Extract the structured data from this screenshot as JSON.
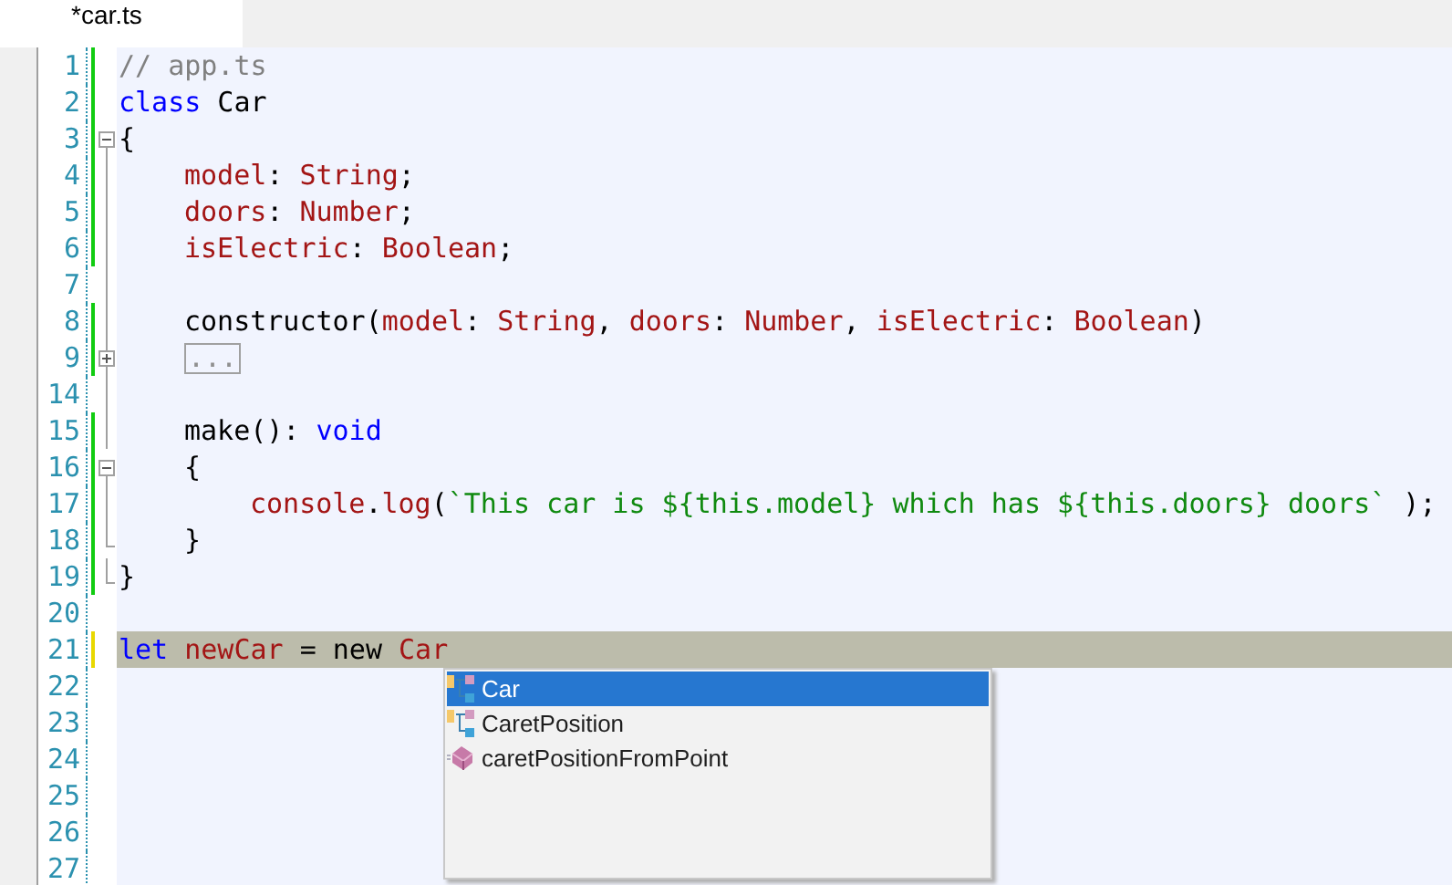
{
  "tabs": [
    {
      "title": "*car.ts",
      "selected": true
    }
  ],
  "editor": {
    "lines": [
      {
        "number": "1",
        "modified": true,
        "saved": true,
        "current": false,
        "tokens": [
          {
            "kind": "comment",
            "text": "// app.ts"
          }
        ]
      },
      {
        "number": "2",
        "modified": true,
        "saved": true,
        "current": false,
        "tokens": [
          {
            "kind": "keyword",
            "text": "class"
          },
          {
            "kind": "plain",
            "text": " Car"
          }
        ]
      },
      {
        "number": "3",
        "modified": true,
        "saved": true,
        "fold_button": true,
        "collapsed": false,
        "current": false,
        "tokens": [
          {
            "kind": "plain",
            "text": "{"
          }
        ]
      },
      {
        "number": "4",
        "modified": true,
        "saved": true,
        "fold_line": true,
        "indented": true,
        "current": false,
        "tokens": [
          {
            "kind": "identifier",
            "text": "model"
          },
          {
            "kind": "plain",
            "text": ": "
          },
          {
            "kind": "identifier",
            "text": "String"
          },
          {
            "kind": "plain",
            "text": ";"
          }
        ]
      },
      {
        "number": "5",
        "modified": true,
        "saved": true,
        "fold_line": true,
        "indented": true,
        "current": false,
        "tokens": [
          {
            "kind": "identifier",
            "text": "doors"
          },
          {
            "kind": "plain",
            "text": ": "
          },
          {
            "kind": "identifier",
            "text": "Number"
          },
          {
            "kind": "plain",
            "text": ";"
          }
        ]
      },
      {
        "number": "6",
        "modified": true,
        "saved": true,
        "fold_line": true,
        "indented": true,
        "current": false,
        "tokens": [
          {
            "kind": "identifier",
            "text": "isElectric"
          },
          {
            "kind": "plain",
            "text": ": "
          },
          {
            "kind": "identifier",
            "text": "Boolean"
          },
          {
            "kind": "plain",
            "text": ";"
          }
        ]
      },
      {
        "number": "7",
        "modified": false,
        "fold_line": true,
        "current": false
      },
      {
        "number": "8",
        "modified": true,
        "saved": true,
        "fold_line": true,
        "indented": true,
        "current": false,
        "tokens": [
          {
            "kind": "plain",
            "text": "constructor("
          },
          {
            "kind": "identifier",
            "text": "model"
          },
          {
            "kind": "plain",
            "text": ": "
          },
          {
            "kind": "identifier",
            "text": "String"
          },
          {
            "kind": "plain",
            "text": ", "
          },
          {
            "kind": "identifier",
            "text": "doors"
          },
          {
            "kind": "plain",
            "text": ": "
          },
          {
            "kind": "identifier",
            "text": "Number"
          },
          {
            "kind": "plain",
            "text": ", "
          },
          {
            "kind": "identifier",
            "text": "isElectric"
          },
          {
            "kind": "plain",
            "text": ": "
          },
          {
            "kind": "identifier",
            "text": "Boolean"
          },
          {
            "kind": "plain",
            "text": ")"
          }
        ]
      },
      {
        "number": "9",
        "modified": true,
        "saved": true,
        "fold_button": true,
        "collapsed": true,
        "indented": true,
        "current": false,
        "tokens": [
          {
            "kind": "collapsed",
            "text": "..."
          }
        ]
      },
      {
        "number": "14",
        "modified": false,
        "fold_line": true,
        "current": false
      },
      {
        "number": "15",
        "modified": true,
        "saved": true,
        "fold_line": true,
        "indented": true,
        "current": false,
        "tokens": [
          {
            "kind": "plain",
            "text": "make(): "
          },
          {
            "kind": "keyword",
            "text": "void"
          }
        ]
      },
      {
        "number": "16",
        "modified": true,
        "saved": true,
        "fold_button": true,
        "collapsed": false,
        "indented": true,
        "current": false,
        "tokens": [
          {
            "kind": "plain",
            "text": "{"
          }
        ]
      },
      {
        "number": "17",
        "modified": true,
        "saved": true,
        "fold_line": true,
        "indented": true,
        "nested": true,
        "current": false,
        "tokens": [
          {
            "kind": "identifier",
            "text": "console"
          },
          {
            "kind": "plain",
            "text": "."
          },
          {
            "kind": "identifier",
            "text": "log"
          },
          {
            "kind": "plain",
            "text": "("
          },
          {
            "kind": "string",
            "text": "`This car is ${this.model} which has ${this.doors} doors`"
          },
          {
            "kind": "plain",
            "text": " );"
          }
        ]
      },
      {
        "number": "18",
        "modified": true,
        "saved": true,
        "fold_end": true,
        "indented": true,
        "current": false,
        "tokens": [
          {
            "kind": "plain",
            "text": "}"
          }
        ]
      },
      {
        "number": "19",
        "modified": true,
        "saved": true,
        "fold_end": true,
        "current": false,
        "tokens": [
          {
            "kind": "plain",
            "text": "}"
          }
        ]
      },
      {
        "number": "20",
        "modified": false,
        "current": false
      },
      {
        "number": "21",
        "modified": true,
        "saved": false,
        "current": true,
        "tokens": [
          {
            "kind": "keyword",
            "text": "let "
          },
          {
            "kind": "identifier",
            "text": "newCar"
          },
          {
            "kind": "plain",
            "text": " = new "
          },
          {
            "kind": "identifier",
            "text": "Car"
          }
        ]
      },
      {
        "number": "22",
        "modified": false,
        "current": false
      },
      {
        "number": "23",
        "modified": false,
        "current": false
      },
      {
        "number": "24",
        "modified": false,
        "current": false
      },
      {
        "number": "25",
        "modified": false,
        "current": false
      },
      {
        "number": "26",
        "modified": false,
        "current": false
      },
      {
        "number": "27",
        "modified": false,
        "current": false
      }
    ]
  },
  "completion": {
    "items": [
      {
        "label": "Car",
        "kind": "class",
        "selected": true
      },
      {
        "label": "CaretPosition",
        "kind": "class",
        "selected": false
      },
      {
        "label": "caretPositionFromPoint",
        "kind": "method",
        "selected": false
      }
    ]
  }
}
